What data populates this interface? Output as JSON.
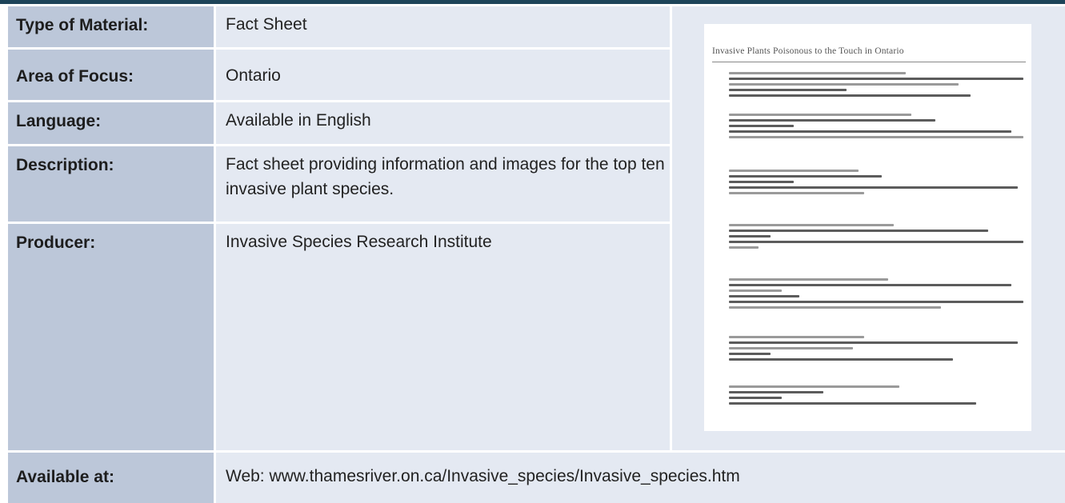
{
  "rows": [
    {
      "label": "Type of Material:",
      "value": "Fact Sheet"
    },
    {
      "label": "Area of Focus:",
      "value": "Ontario"
    },
    {
      "label": "Language:",
      "value": "Available in English"
    },
    {
      "label": "Description:",
      "value": "Fact sheet providing information and images for the top ten invasive plant species."
    },
    {
      "label": "Producer:",
      "value": "Invasive Species Research Institute"
    },
    {
      "label": "Available at:",
      "value": "Web: www.thamesriver.on.ca/Invasive_species/Invasive_species.htm"
    }
  ],
  "thumbnail": {
    "title": "Invasive Plants Poisonous to the Touch in Ontario"
  },
  "colors": {
    "header_bar": "#1d4459",
    "label_bg": "#bcc7d9",
    "value_bg": "#e4e9f2"
  }
}
